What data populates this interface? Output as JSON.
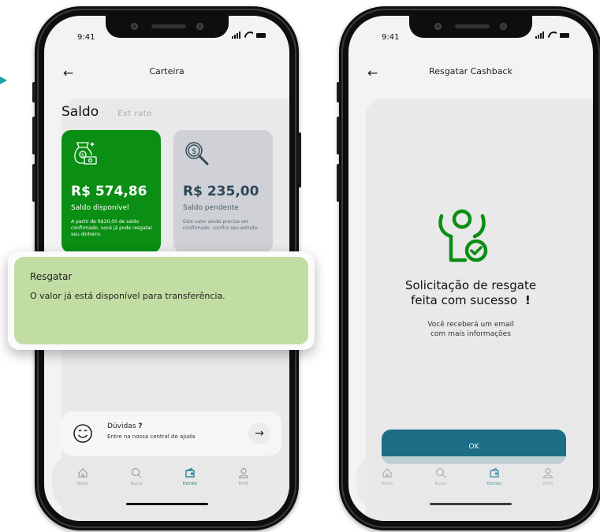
{
  "status_bar": {
    "time": "9:41"
  },
  "left_screen": {
    "header": {
      "title": "Carteira"
    },
    "tabs": {
      "active": "Saldo",
      "inactive": "Ext rato"
    },
    "cards": [
      {
        "amount": "R$ 574,86",
        "label": "Saldo disponível",
        "description": "A partir de R$20,00 de saldo confirmado, você já pode resgatar seu dinheiro.",
        "icon": "money-bag-icon"
      },
      {
        "amount": "R$ 235,00",
        "label": "Saldo pendente",
        "description": "Este valor ainda precisa ser confirmado, confira seu extrato.",
        "icon": "coin-magnifier-icon"
      }
    ],
    "toast": {
      "title": "Resgatar",
      "message": "O valor já está disponível para transferência."
    },
    "help": {
      "title": "Dúvidas",
      "title_mark": "?",
      "subtitle": "Entre na nossa central de ajuda"
    }
  },
  "right_screen": {
    "header": {
      "title": "Resgatar Cashback"
    },
    "success": {
      "line1": "Solicitação de resgate",
      "line2": "feita com sucesso",
      "exclamation": "!",
      "sub1": "Você receberá um email",
      "sub2": "com mais informações"
    },
    "ok_label": "OK"
  },
  "nav": [
    {
      "label": "Home",
      "icon": "home-icon"
    },
    {
      "label": "Busca",
      "icon": "search-icon"
    },
    {
      "label": "Extrato",
      "icon": "wallet-icon"
    },
    {
      "label": "Perfil",
      "icon": "user-icon"
    }
  ],
  "colors": {
    "green_card": "#0a8e13",
    "grey_card": "#cfd1d6",
    "toast": "#c2dda3",
    "ok_button": "#1b6e86",
    "accent_icon": "#0a8e13",
    "arrow": "#1ba3a8"
  }
}
